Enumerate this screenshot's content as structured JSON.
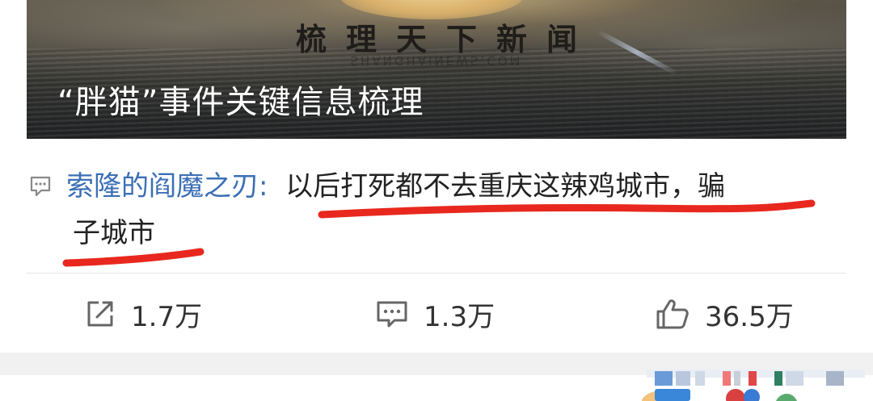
{
  "banner": {
    "motto": "梳理天下新闻",
    "watermark": "SHANGHAINEWS.COM",
    "headline": "“胖猫”事件关键信息梳理"
  },
  "comment": {
    "icon": "comment-icon",
    "author": "索隆的阎魔之刃",
    "separator": ":",
    "text_line1": "以后打死都不去重庆这辣鸡城市，骗",
    "text_line2": "子城市",
    "underline_color": "#e8281e"
  },
  "actions": {
    "share": {
      "icon": "share-icon",
      "count": "1.7万"
    },
    "comments": {
      "icon": "comment-icon",
      "count": "1.3万"
    },
    "likes": {
      "icon": "thumbs-up-icon",
      "count": "36.5万"
    }
  },
  "colors": {
    "author_link": "#3b6fb6",
    "text": "#222222",
    "icon_gray": "#666666"
  }
}
